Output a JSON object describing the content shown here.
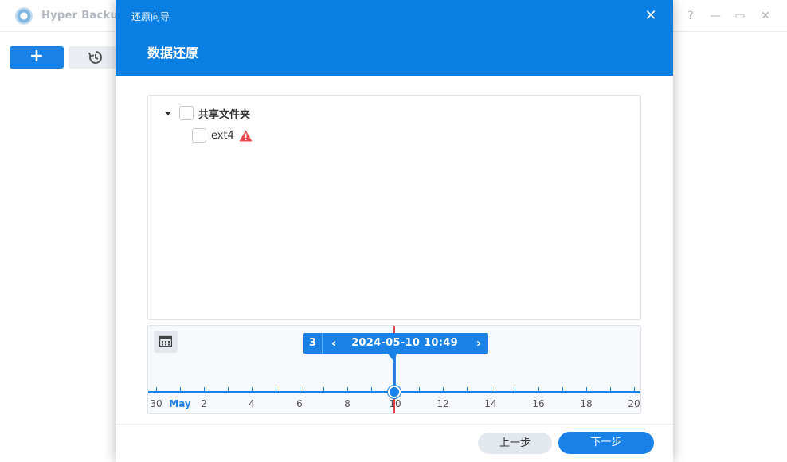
{
  "app": {
    "title": "Hyper Backup",
    "help_glyph": "?",
    "minimize_glyph": "—",
    "maximize_glyph": "▭",
    "close_glyph": "✕",
    "add_glyph": "+"
  },
  "modal": {
    "title": "还原向导",
    "heading": "数据还原",
    "close_glyph": "✕"
  },
  "tree": {
    "items": [
      {
        "label": "共享文件夹",
        "expanded": true,
        "checked": false
      },
      {
        "label": "ext4",
        "checked": false,
        "warning": true
      }
    ]
  },
  "timeline": {
    "version_count": "3",
    "prev_glyph": "‹",
    "next_glyph": "›",
    "selected_datetime": "2024-05-10 10:49",
    "axis_labels": [
      "30",
      "May",
      "2",
      "4",
      "6",
      "8",
      "10",
      "12",
      "14",
      "16",
      "18",
      "20"
    ],
    "month_label": "May"
  },
  "footer": {
    "prev_label": "上一步",
    "next_label": "下一步"
  },
  "colors": {
    "accent": "#1a82e6",
    "header": "#0a7fe3",
    "marker": "#e0404a",
    "warning": "#e8474f"
  }
}
